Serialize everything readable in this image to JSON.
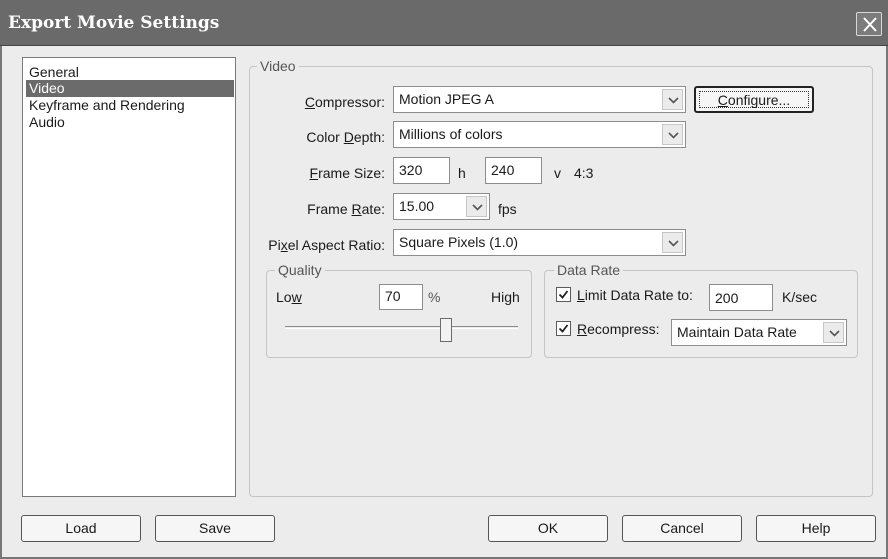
{
  "window": {
    "title": "Export Movie Settings"
  },
  "sidebar": {
    "items": [
      {
        "label": "General"
      },
      {
        "label": "Video"
      },
      {
        "label": "Keyframe and Rendering"
      },
      {
        "label": "Audio"
      }
    ],
    "selected": "Video"
  },
  "video": {
    "legend": "Video",
    "compressor": {
      "label_pre": "",
      "label_key": "C",
      "label_post": "ompressor:",
      "value": "Motion JPEG A",
      "configure_label_key": "C",
      "configure_label_post": "onfigure..."
    },
    "color_depth": {
      "label_pre": "Color ",
      "label_key": "D",
      "label_post": "epth:",
      "value": "Millions of colors"
    },
    "frame_size": {
      "label_pre": "",
      "label_key": "F",
      "label_post": "rame Size:",
      "width": "320",
      "h_label": "h",
      "height": "240",
      "v_label": "v",
      "ratio": "4:3"
    },
    "frame_rate": {
      "label_pre": "Frame ",
      "label_key": "R",
      "label_post": "ate:",
      "value": "15.00",
      "unit": "fps"
    },
    "pixel_aspect": {
      "label_pre": "Pi",
      "label_key": "x",
      "label_post": "el Aspect Ratio:",
      "value": "Square Pixels (1.0)"
    },
    "quality": {
      "legend": "Quality",
      "low_pre": "Lo",
      "low_key": "w",
      "value": "70",
      "percent": "%",
      "high": "High",
      "slider_value": 70
    },
    "data_rate": {
      "legend": "Data Rate",
      "limit_checked": true,
      "limit_key": "L",
      "limit_post": "imit Data Rate to:",
      "limit_value": "200",
      "limit_unit": "K/sec",
      "recompress_checked": true,
      "recompress_key": "R",
      "recompress_post": "ecompress:",
      "recompress_value": "Maintain Data Rate"
    }
  },
  "buttons": {
    "load": "Load",
    "save": "Save",
    "ok": "OK",
    "cancel": "Cancel",
    "help": "Help"
  }
}
